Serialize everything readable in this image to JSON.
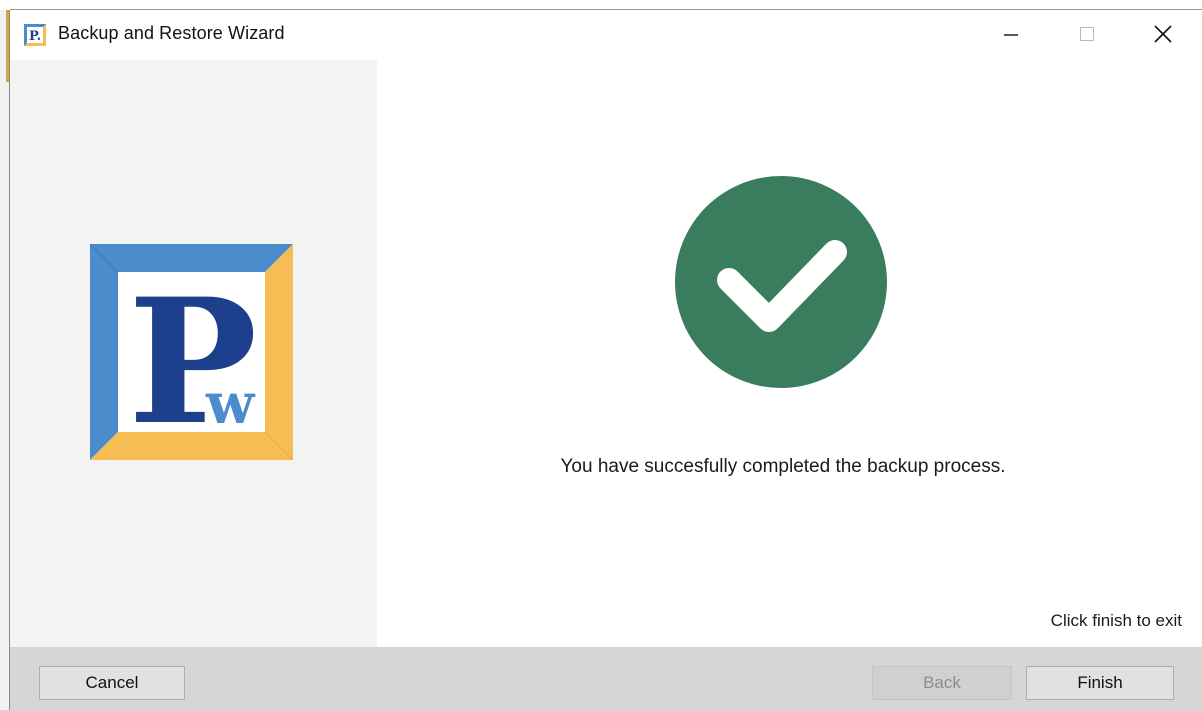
{
  "window": {
    "title": "Backup and Restore Wizard",
    "controls": {
      "minimize": "minimize",
      "maximize": "maximize",
      "close": "close"
    }
  },
  "app_icon": {
    "letter": "P.",
    "icon": "app-logo-icon"
  },
  "logo": {
    "icon": "pw-logo",
    "main_letter": "P",
    "sub_letter": "w",
    "colors": {
      "blue_frame": "#4a8ccc",
      "gold_frame": "#f6bd55",
      "letter_blue": "#1e3f8c",
      "sub_blue": "#4a8ccc"
    }
  },
  "content": {
    "status_icon": "check-circle-icon",
    "status_color": "#3a7d5e",
    "message": "You have succesfully completed the backup process.",
    "hint": "Click finish to exit"
  },
  "buttons": {
    "cancel": "Cancel",
    "back": "Back",
    "back_enabled": false,
    "finish": "Finish"
  }
}
